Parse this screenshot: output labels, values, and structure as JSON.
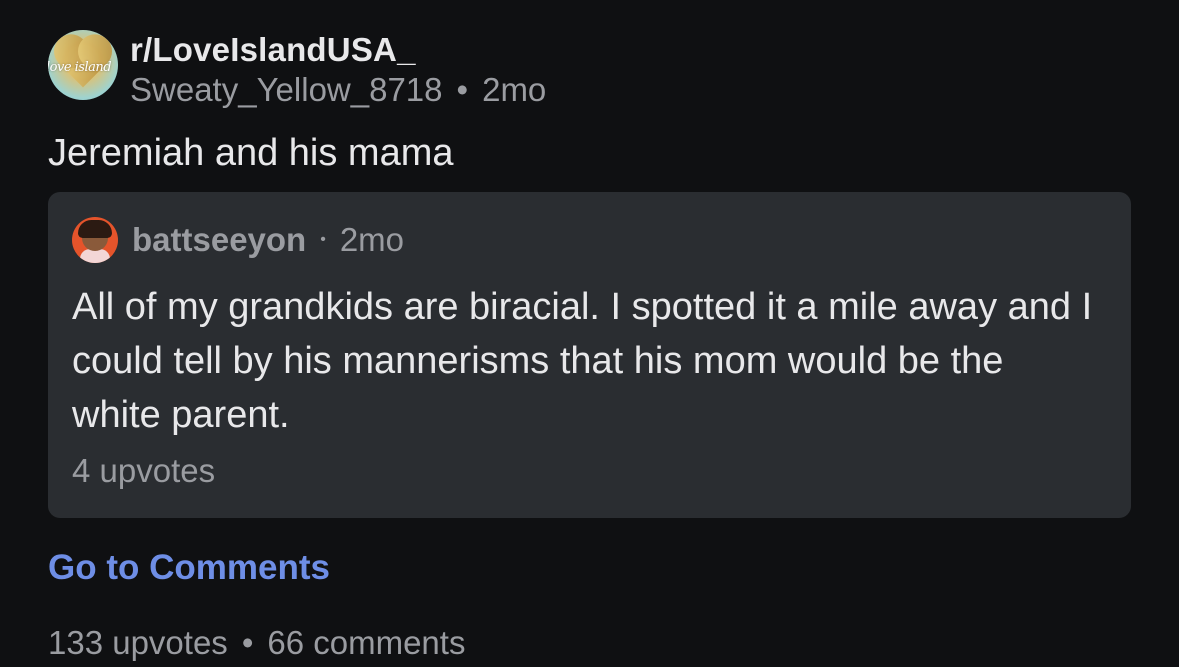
{
  "post": {
    "subreddit": "r/LoveIslandUSA_",
    "author": "Sweaty_Yellow_8718",
    "age": "2mo",
    "title": "Jeremiah and his mama",
    "subreddit_icon_text": "love island"
  },
  "quoted_comment": {
    "username": "battseeyon",
    "age": "2mo",
    "body": "All of my grandkids are biracial. I spotted it a mile away and I could tell by his mannerisms that his mom would be the white parent.",
    "upvotes": "4 upvotes"
  },
  "actions": {
    "go_to_comments": "Go to Comments"
  },
  "stats": {
    "upvotes": "133 upvotes",
    "comments": "66 comments"
  },
  "separator": "•",
  "colors": {
    "background": "#0f1012",
    "card": "#2a2d31",
    "link": "#6e8ee6",
    "muted": "#9a9ca1",
    "text": "#e8e8ea"
  }
}
